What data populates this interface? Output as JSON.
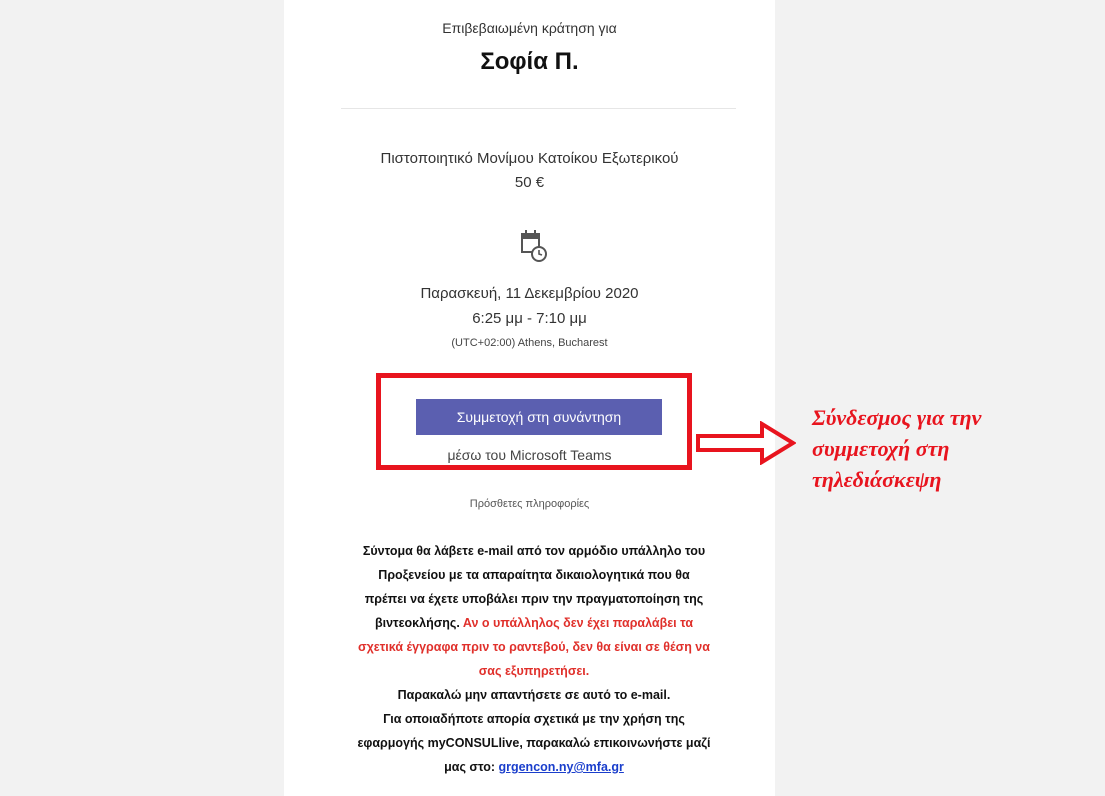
{
  "booking": {
    "subtitle": "Επιβεβαιωμένη κράτηση για",
    "name": "Σοφία Π.",
    "service": "Πιστοποιητικό Μονίμου Κατοίκου Εξωτερικού",
    "price": "50 €",
    "date": "Παρασκευή, 11 Δεκεμβρίου 2020",
    "time": "6:25 μμ - 7:10 μμ",
    "timezone": "(UTC+02:00) Athens, Bucharest"
  },
  "join": {
    "button_label": "Συμμετοχή στη συνάντηση",
    "via": "μέσω του Microsoft Teams"
  },
  "info": {
    "heading": "Πρόσθετες πληροφορίες",
    "line1": "Σύντομα θα λάβετε e-mail από τον αρμόδιο υπάλληλο του",
    "line2": "Προξενείου με τα απαραίτητα δικαιολογητικά που θα",
    "line3": "πρέπει να έχετε υποβάλει πριν την πραγματοποίηση της",
    "line4a": "βιντεοκλήσης. ",
    "line4b": "Αν ο υπάλληλος δεν έχει παραλάβει τα",
    "line5": "σχετικά έγγραφα πριν το ραντεβού, δεν θα είναι σε θέση να",
    "line6": "σας εξυπηρετήσει.",
    "line7": "Παρακαλώ μην απαντήσετε σε αυτό το e-mail.",
    "line8": "Για οποιαδήποτε απορία σχετικά με την χρήση της",
    "line9": "εφαρμογής myCONSULlive, παρακαλώ επικοινωνήστε μαζί",
    "line10_prefix": "μας στο: ",
    "email": "grgencon.ny@mfa.gr"
  },
  "annotation": {
    "line1": "Σύνδεσμος για την",
    "line2": "συμμετοχή στη",
    "line3": "τηλεδιάσκεψη"
  },
  "colors": {
    "button": "#5b5fb0",
    "highlight_red": "#e8141e",
    "warning_red": "#e0302b",
    "link": "#1a3ecc"
  },
  "icons": {
    "calendar": "calendar-clock-icon",
    "arrow": "right-arrow-icon"
  }
}
